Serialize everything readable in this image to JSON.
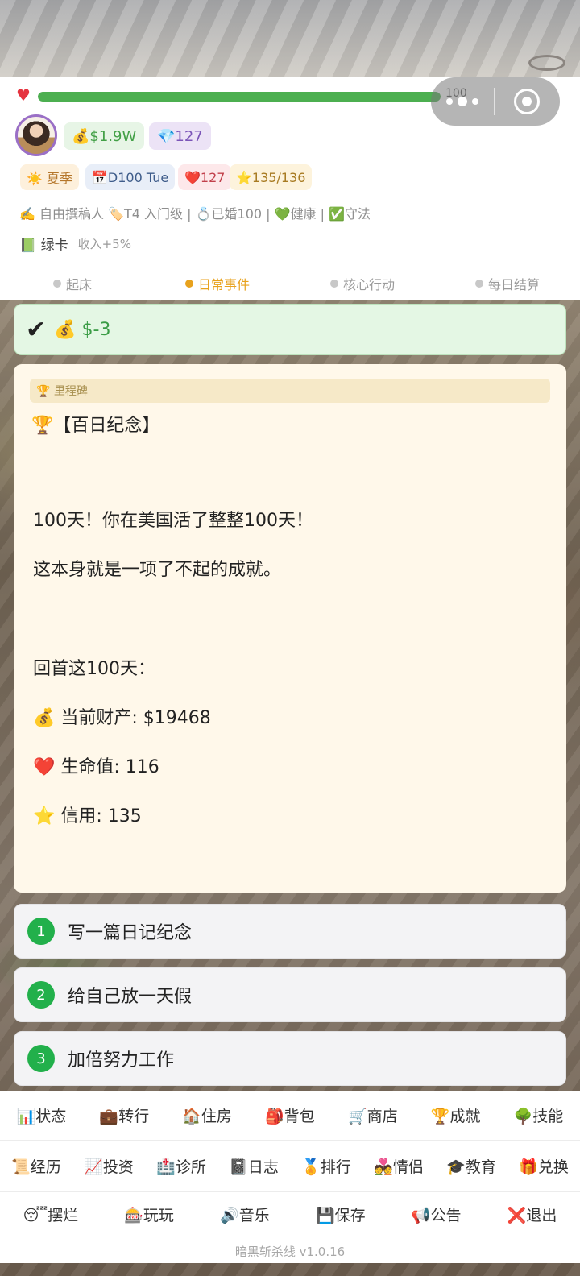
{
  "colors": {
    "hp_green": "#4caf50",
    "accent_orange": "#e8a21d",
    "choice_green": "#22b04b",
    "result_green": "#3a9c45"
  },
  "status": {
    "hp_value": "100",
    "hp_fraction": 1.0,
    "money": "💰$1.9W",
    "gems": "💎127",
    "season": "☀️ 夏季",
    "day": "📅D100 Tue",
    "health": "❤️127",
    "credit": "⭐135/136",
    "info_line": "✍️ 自由撰稿人 🏷️T4 入门级 | 💍已婚100 | 💚健康 | ✅守法",
    "green_card_label": "📗 绿卡",
    "green_card_bonus": "收入+5%"
  },
  "steps": [
    {
      "label": "起床",
      "active": false
    },
    {
      "label": "日常事件",
      "active": true
    },
    {
      "label": "核心行动",
      "active": false
    },
    {
      "label": "每日结算",
      "active": false
    }
  ],
  "result": {
    "check": "✔",
    "text": "💰 $-3"
  },
  "event": {
    "tag": "🏆 里程碑",
    "title": "🏆【百日纪念】",
    "lines": [
      "100天！你在美国活了整整100天！",
      "这本身就是一项了不起的成就。",
      "回首这100天：",
      "💰 当前财产: $19468",
      "❤️ 生命值: 116",
      "⭐ 信用: 135"
    ]
  },
  "choices": [
    {
      "num": "1",
      "label": "写一篇日记纪念"
    },
    {
      "num": "2",
      "label": "给自己放一天假"
    },
    {
      "num": "3",
      "label": "加倍努力工作"
    }
  ],
  "nav": {
    "row1": [
      "📊状态",
      "💼转行",
      "🏠住房",
      "🎒背包",
      "🛒商店",
      "🏆成就",
      "🌳技能"
    ],
    "row2": [
      "📜经历",
      "📈投资",
      "🏥诊所",
      "📓日志",
      "🏅排行",
      "💑情侣",
      "🎓教育",
      "🎁兑换"
    ],
    "row3": [
      "😴摆烂",
      "🎰玩玩",
      "🔊音乐",
      "💾保存",
      "📢公告",
      "❌退出"
    ]
  },
  "version": "暗黑斩杀线 v1.0.16"
}
